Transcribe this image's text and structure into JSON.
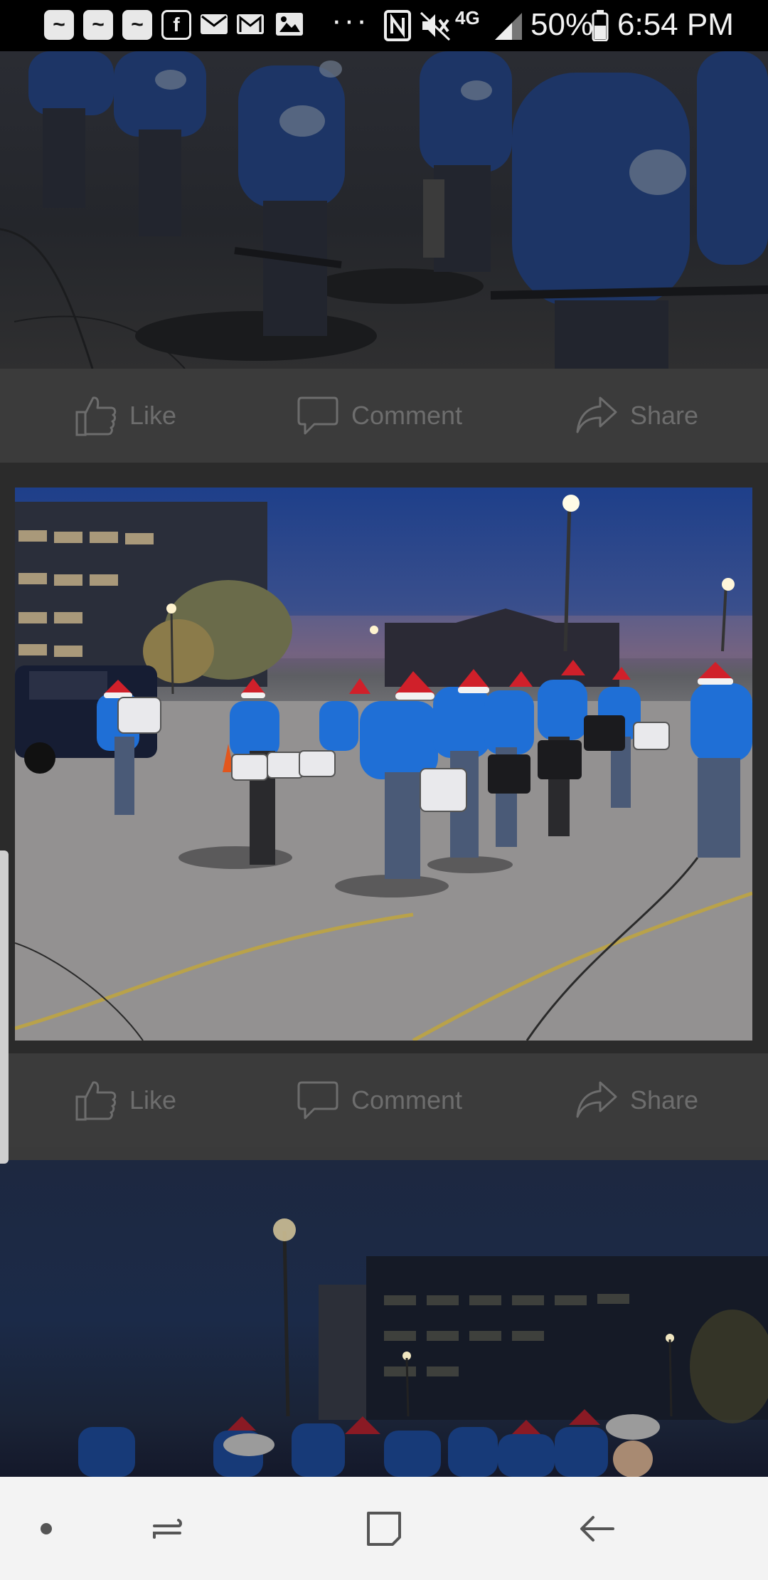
{
  "status_bar": {
    "notification_icons": [
      "app-icon",
      "app-icon",
      "app-icon",
      "facebook-icon",
      "mail-icon",
      "gmail-icon",
      "image-icon"
    ],
    "more_indicator": "···",
    "network_label": "4G",
    "battery_percent": "50%",
    "time": "6:54 PM"
  },
  "posts": [
    {
      "actions": {
        "like": "Like",
        "comment": "Comment",
        "share": "Share"
      }
    },
    {
      "actions": {
        "like": "Like",
        "comment": "Comment",
        "share": "Share"
      }
    }
  ],
  "colors": {
    "hoodie_blue": "#1f6fd6",
    "santa_red": "#d0202a",
    "action_text": "#6d6d6d"
  }
}
